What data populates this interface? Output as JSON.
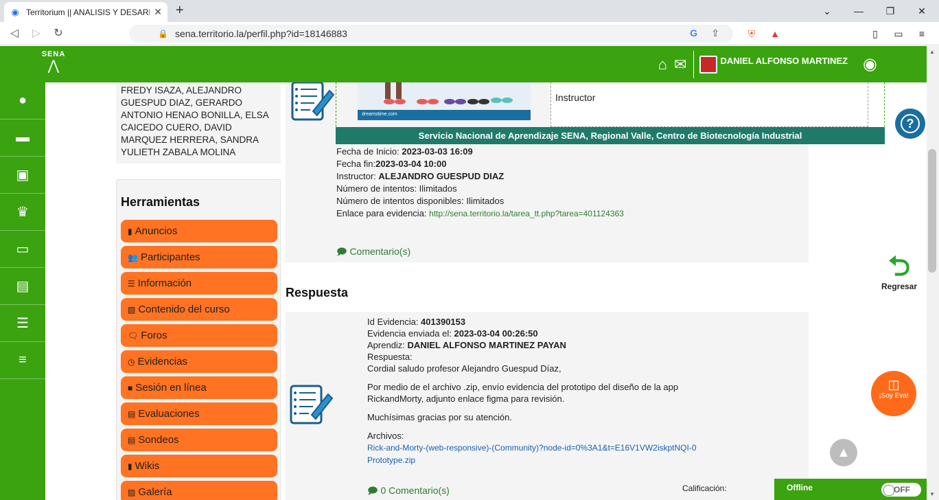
{
  "browser": {
    "tab_title": "Territorium || ANALISIS Y DESARR",
    "url": "sena.territorio.la/perfil.php?id=18146883",
    "ext_badge_1": "2",
    "ext_badge_2": "1"
  },
  "header": {
    "logo_text": "SENA",
    "user_name": "DANIEL ALFONSO MARTINEZ"
  },
  "sidebar_icons": [
    "user-icon",
    "briefcase-icon",
    "newspaper-icon",
    "trophy-icon",
    "inbox-icon",
    "list-alt-icon",
    "list-icon",
    "menu-icon"
  ],
  "participants_text": "FREDY ISAZA, ALEJANDRO GUESPUD DIAZ, GERARDO ANTONIO HENAO BONILLA, ELSA CAICEDO CUERO, DAVID MARQUEZ HERRERA, SANDRA YULIETH ZABALA MOLINA",
  "tools": {
    "title": "Herramientas",
    "items": [
      "Anuncios",
      "Participantes",
      "Información",
      "Contenido del curso",
      "Foros",
      "Evidencias",
      "Sesión en línea",
      "Evaluaciones",
      "Sondeos",
      "Wikis",
      "Galería"
    ]
  },
  "task": {
    "image_credit": "dreamstime.com",
    "role_label": "Instructor",
    "banner": "Servicio Nacional de Aprendizaje SENA, Regional Valle, Centro de Biotecnología Industrial",
    "start_label": "Fecha de Inicio: ",
    "start_value": "2023-03-03 16:09",
    "end_label": "Fecha fin:",
    "end_value": "2023-03-04 10:00",
    "instructor_label": "Instructor: ",
    "instructor_value": "ALEJANDRO GUESPUD DIAZ",
    "attempts": "Número de intentos: Ilimitados",
    "attempts_available": "Número de intentos disponibles: Ilimitados",
    "link_label": "Enlace para evidencia: ",
    "link_value": "http://sena.territorio.la/tarea_tt.php?tarea=401124363",
    "comments": "Comentario(s)"
  },
  "response": {
    "title": "Respuesta",
    "id_label": "Id Evidencia: ",
    "id_value": "401390153",
    "sent_label": "Evidencia enviada el: ",
    "sent_value": "2023-03-04 00:26:50",
    "student_label": "Aprendiz: ",
    "student_value": "DANIEL ALFONSO MARTINEZ PAYAN",
    "answer_label": "Respuesta:",
    "line1": "Cordial saludo profesor Alejandro Guespud Díaz,",
    "line2": "Por medio de el archivo .zip, envío evidencia del prototipo del diseño de la app RickandMorty, adjunto enlace figma para revisión.",
    "line3": "Muchísimas gracias por su atención.",
    "files_label": "Archivos:",
    "file1": "Rick-and-Morty-(web-responsive)-(Community)?node-id=0%3A1&t=E16V1VW2iskptNQI-0",
    "file2": "Prototype.zip",
    "comments": "0 Comentario(s)",
    "grade_label": "Calificación:"
  },
  "side": {
    "back_label": "Regresar",
    "eva_label": "¡Soy Eva!",
    "offline_label": "Offline",
    "toggle_label": "OFF"
  }
}
